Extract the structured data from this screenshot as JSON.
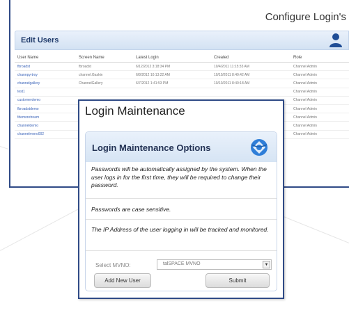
{
  "back_window": {
    "title": "Configure Login's",
    "panel_title": "Edit Users",
    "columns": [
      "User Name",
      "Screen Name",
      "Latest Login",
      "Created",
      "Role"
    ],
    "rows": [
      [
        "fbroadst",
        "fbroadst",
        "6/12/2012 3:18:34 PM",
        "10/4/2011 11:15:33 AM",
        "Channel Admin"
      ],
      [
        "channpyrtroy",
        "channel.Gaskin",
        "6/8/2012 10:13:22 AM",
        "10/10/2011 8:40:42 AM",
        "Channel Admin"
      ],
      [
        "channelgallery",
        "ChannelGallery",
        "6/7/2012 1:41:53 PM",
        "10/10/2011 8:40:18 AM",
        "Channel Admin"
      ],
      [
        "test1",
        "",
        "",
        "",
        "Channel Admin"
      ],
      [
        "customerdemo",
        "",
        "",
        "",
        "Channel Admin"
      ],
      [
        "fbroadstdemo",
        "",
        "",
        "",
        "Channel Admin"
      ],
      [
        "fdemoretream",
        "",
        "",
        "",
        "Channel Admin"
      ],
      [
        "channeldemo",
        "",
        "",
        "",
        "Channel Admin"
      ],
      [
        "channelmvno002",
        "",
        "",
        "",
        "Channel Admin"
      ]
    ]
  },
  "dialog": {
    "title": "Login Maintenance",
    "panel_title": "Login Maintenance Options",
    "note1": "Passwords will be automatically assigned by the system. When the user logs in for the first time, they will be required to change their password.",
    "note2": "Passwords are case sensitive.",
    "note3": "The IP Address of the user logging in will be tracked and monitored.",
    "mvno_label": "Select MVNO:",
    "mvno_value": "talSPACE MVNO",
    "add_user_label": "Add New User",
    "submit_label": "Submit"
  },
  "colors": {
    "window_border": "#2f4a86",
    "panel_header": "#d6e4f4",
    "link": "#3a63b8"
  },
  "icons": [
    "user-icon",
    "globe-icon",
    "dropdown-arrow-icon"
  ]
}
